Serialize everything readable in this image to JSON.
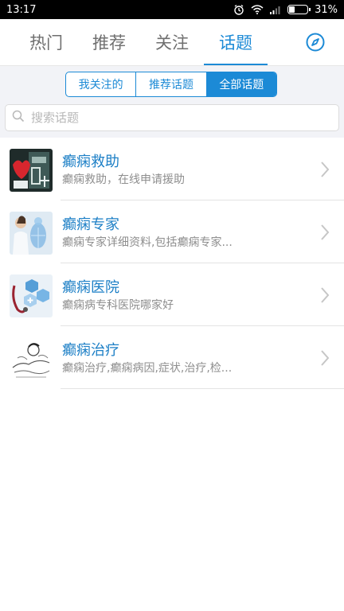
{
  "status_bar": {
    "time": "13:17",
    "battery_percent": "31%",
    "battery_level": 0.31,
    "icons": [
      "alarm-icon",
      "wifi-icon",
      "signal-icon",
      "battery-icon"
    ]
  },
  "top_tabs": [
    {
      "label": "热门",
      "active": false
    },
    {
      "label": "推荐",
      "active": false
    },
    {
      "label": "关注",
      "active": false
    },
    {
      "label": "话题",
      "active": true
    }
  ],
  "topic_filter": {
    "options": [
      "我关注的",
      "推荐话题",
      "全部话题"
    ],
    "selected": "全部话题"
  },
  "search": {
    "placeholder": "搜索话题",
    "value": ""
  },
  "topics": [
    {
      "title": "癫痫救助",
      "description": "癫痫救助，在线申请援助",
      "thumbnail": "medical-aid-image"
    },
    {
      "title": "癫痫专家",
      "description": "癫痫专家详细资料,包括癫痫专家...",
      "thumbnail": "doctor-image"
    },
    {
      "title": "癫痫医院",
      "description": "癫痫病专科医院哪家好",
      "thumbnail": "hospital-image"
    },
    {
      "title": "癫痫治疗",
      "description": "癫痫治疗,癫痫病因,症状,治疗,检...",
      "thumbnail": "treatment-sketch-image"
    }
  ],
  "colors": {
    "accent": "#1c8ad6",
    "title_text": "#1c7fc6",
    "secondary_text": "#8e8e8e",
    "background_gray": "#f2f3f7"
  }
}
